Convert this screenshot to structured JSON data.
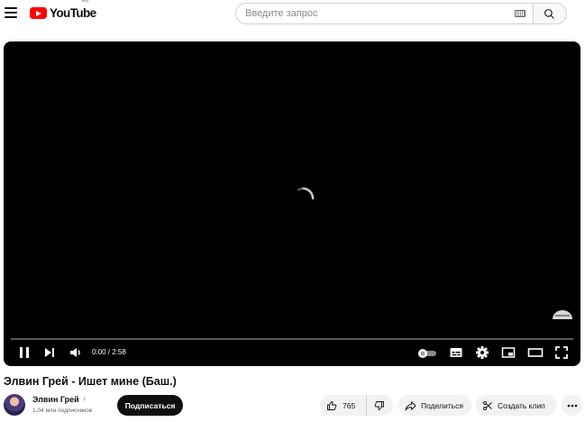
{
  "masthead": {
    "logo_text": "YouTube",
    "region": "RU",
    "search_placeholder": "Введите запрос"
  },
  "player": {
    "time_display": "0:00 / 2:58",
    "state": "buffering",
    "progress": 0
  },
  "video": {
    "title": "Элвин Грей - Ишет мине (Баш.)"
  },
  "channel": {
    "name": "Элвин Грей",
    "subscribers": "1,04 млн подписчиков",
    "subscribe_label": "Подписаться"
  },
  "actions": {
    "like_count": "765",
    "share_label": "Поделиться",
    "clip_label": "Создать клип"
  },
  "icons": [
    "menu-icon",
    "search-icon",
    "keyboard-icon",
    "pause-icon",
    "next-icon",
    "volume-icon",
    "autoplay-toggle",
    "subtitles-icon",
    "settings-icon",
    "miniplayer-icon",
    "theater-icon",
    "fullscreen-icon",
    "like-icon",
    "dislike-icon",
    "share-icon",
    "scissors-icon",
    "more-icon",
    "music-note-icon"
  ],
  "colors": {
    "brand": "#ff0000",
    "text": "#0f0f0f",
    "secondary": "#606060",
    "pill": "#f2f2f2"
  }
}
